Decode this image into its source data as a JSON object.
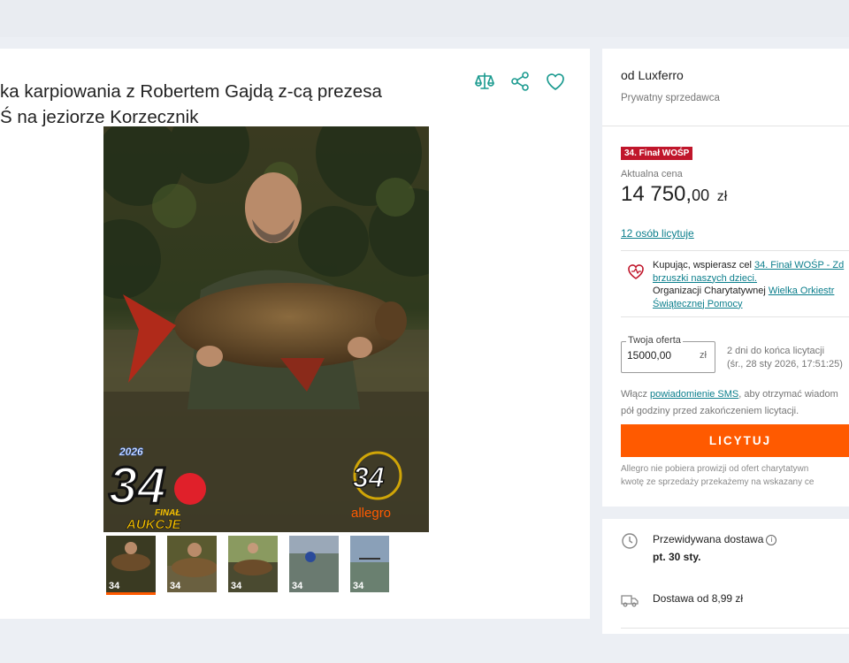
{
  "listing": {
    "title_line1": "ka karpiowania z Robertem Gajdą z-cą prezesa",
    "title_line2": "Ś na jeziorze Korzecznik",
    "photo_logo_year": "2026",
    "photo_logo_number": "34",
    "photo_logo_final": "FINAŁ",
    "photo_logo_aukcje": "AUKCJE",
    "photo_brand": "allegro",
    "thumbnail_count": 5,
    "active_thumbnail": 1
  },
  "actions": {
    "compare_icon": "scales-icon",
    "share_icon": "share-icon",
    "favorite_icon": "heart-icon"
  },
  "seller": {
    "name": "od Luxferro",
    "type": "Prywatny sprzedawca"
  },
  "auction": {
    "badge": "34. Finał WOŚP",
    "price_label": "Aktualna cena",
    "price_int": "14 750,",
    "price_dec": "00",
    "price_currency": "zł",
    "bidders_link": "12 osób licytuje",
    "charity_line1_pre": "Kupując, wspierasz cel ",
    "charity_line1_link": "34. Finał WOŚP - Zd",
    "charity_line2_link": "brzuszki naszych dzieci.",
    "charity_line3_pre": "Organizacji Charytatywnej ",
    "charity_line3_link": "Wielka Orkiestr",
    "charity_line4_link": "Świątecznej Pomocy",
    "offer_label": "Twoja oferta",
    "offer_value": "15000,00",
    "offer_currency": "zł",
    "ends_line1": "2 dni do końca licytacji",
    "ends_line2": "(śr., 28 sty 2026, 17:51:25)",
    "sms_pre": "Włącz ",
    "sms_link": "powiadomienie SMS",
    "sms_post": ", aby otrzymać wiadom",
    "sms_line2": "pół godziny przed zakończeniem licytacji.",
    "bid_button": "LICYTUJ",
    "disclaimer_line1": "Allegro nie pobiera prowizji od ofert charytatywn",
    "disclaimer_line2": "kwotę ze sprzedaży przekażemy na wskazany ce"
  },
  "shipping": {
    "delivery_label": "Przewidywana dostawa",
    "delivery_date": "pt. 30 sty.",
    "delivery_from": "Dostawa od 8,99 zł"
  },
  "colors": {
    "accent": "#ff5a00",
    "link": "#0b7e8c",
    "badge": "#c0162b",
    "icon_teal": "#1a9a8f"
  }
}
